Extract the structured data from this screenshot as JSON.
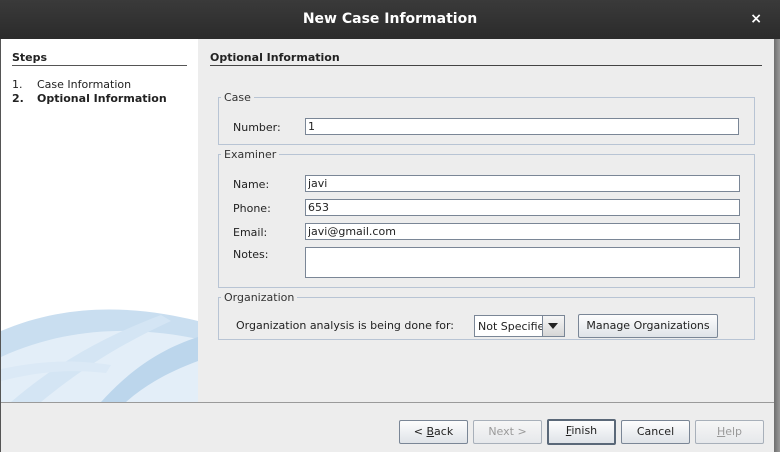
{
  "window": {
    "title": "New Case Information",
    "close_symbol": "×"
  },
  "steps": {
    "header": "Steps",
    "items": [
      {
        "num": "1.",
        "label": "Case Information"
      },
      {
        "num": "2.",
        "label": "Optional Information"
      }
    ]
  },
  "content": {
    "header": "Optional Information",
    "case": {
      "legend": "Case",
      "number_label": "Number:",
      "number_value": "1"
    },
    "examiner": {
      "legend": "Examiner",
      "name_label": "Name:",
      "name_value": "javi",
      "phone_label": "Phone:",
      "phone_value": "653",
      "email_label": "Email:",
      "email_value": "javi@gmail.com",
      "notes_label": "Notes:",
      "notes_value": ""
    },
    "organization": {
      "legend": "Organization",
      "prompt": "Organization analysis is being done for:",
      "selected": "Not Specified",
      "manage_button": "Manage Organizations"
    }
  },
  "buttons": {
    "back_prefix": "< ",
    "back_mnemonic": "B",
    "back_rest": "ack",
    "next": "Next >",
    "finish_mnemonic": "F",
    "finish_rest": "inish",
    "cancel": "Cancel",
    "help_mnemonic": "H",
    "help_rest": "elp"
  },
  "colors": {
    "titlebar": "#2f2f2f",
    "panel_bg": "#ededed",
    "field_border": "#7a8696",
    "fieldset_border": "#b8c4d4",
    "decor_blue": "#c5dcf0"
  }
}
